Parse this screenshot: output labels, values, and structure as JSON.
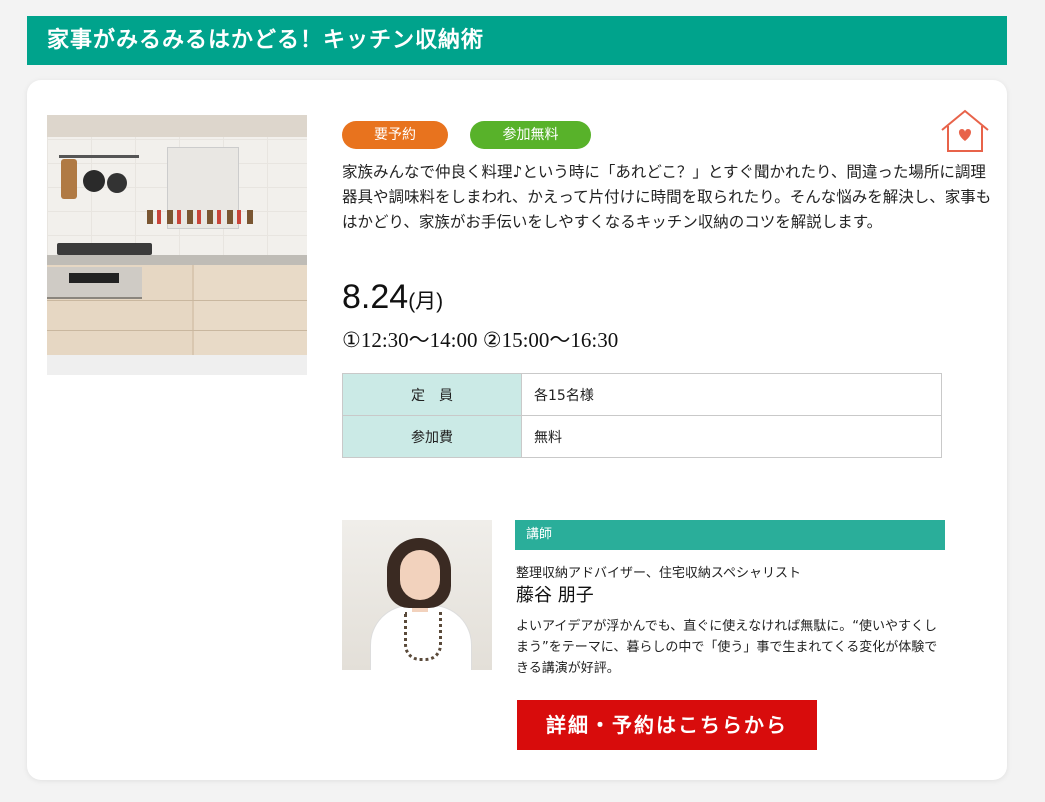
{
  "header": {
    "title": "家事がみるみるはかどる！キッチン収納術"
  },
  "event": {
    "photo_alt": "kitchen-photo",
    "badges": {
      "reservation": "要予約",
      "free": "参加無料"
    },
    "favorite_icon": "heart-house-icon",
    "description": "家族みんなで仲良く料理♪という時に「あれどこ？」とすぐ聞かれたり、間違った場所に調理器具や調味料をしまわれ、かえって片付けに時間を取られたり。そんな悩みを解決し、家事もはかどり、家族がお手伝いをしやすくなるキッチン収納のコツを解説します。",
    "date": "8.24",
    "day_of_week": "(月)",
    "times": "①12:30〜14:00 ②15:00〜16:30",
    "table": [
      {
        "label": "定　員",
        "value": "各15名様"
      },
      {
        "label": "参加費",
        "value": "無料"
      }
    ]
  },
  "lecturer": {
    "heading": "講師",
    "role": "整理収納アドバイザー、住宅収納スペシャリスト",
    "name": "藤谷 朋子",
    "bio": "よいアイデアが浮かんでも、直ぐに使えなければ無駄に。“使いやすくしまう”をテーマに、暮らしの中で「使う」事で生まれてくる変化が体験できる講演が好評。"
  },
  "cta": {
    "label": "詳細・予約はこちらから"
  },
  "colors": {
    "brand_green": "#00a38c",
    "badge_orange": "#e8731e",
    "badge_green": "#58b22a",
    "cta_red": "#d80c0c",
    "heart": "#e8634a"
  }
}
